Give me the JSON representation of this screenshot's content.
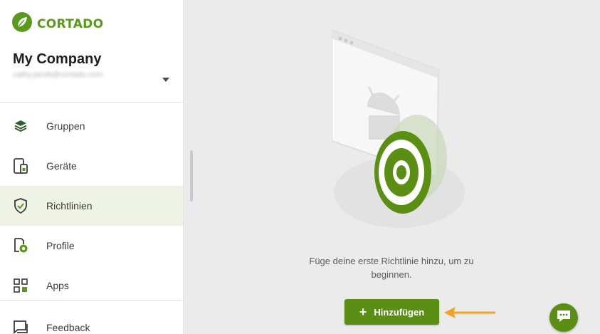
{
  "brand": {
    "name": "CORTADO"
  },
  "company": {
    "name": "My Company",
    "email": "cathy.jacob@cortado.com"
  },
  "nav": {
    "items": [
      {
        "label": "Gruppen",
        "icon": "layers-icon"
      },
      {
        "label": "Geräte",
        "icon": "devices-icon"
      },
      {
        "label": "Richtlinien",
        "icon": "shield-check-icon",
        "active": true
      },
      {
        "label": "Profile",
        "icon": "profile-settings-icon"
      },
      {
        "label": "Apps",
        "icon": "apps-grid-icon"
      }
    ],
    "feedback": {
      "label": "Feedback",
      "icon": "feedback-icon"
    }
  },
  "main": {
    "empty_text": "Füge deine erste Richtlinie hinzu, um zu beginnen.",
    "add_button": "Hinzufügen"
  },
  "colors": {
    "accent": "#5a8f14",
    "brand": "#5a9a1a",
    "arrow": "#f5a020",
    "active_bg": "#eef3e6"
  }
}
